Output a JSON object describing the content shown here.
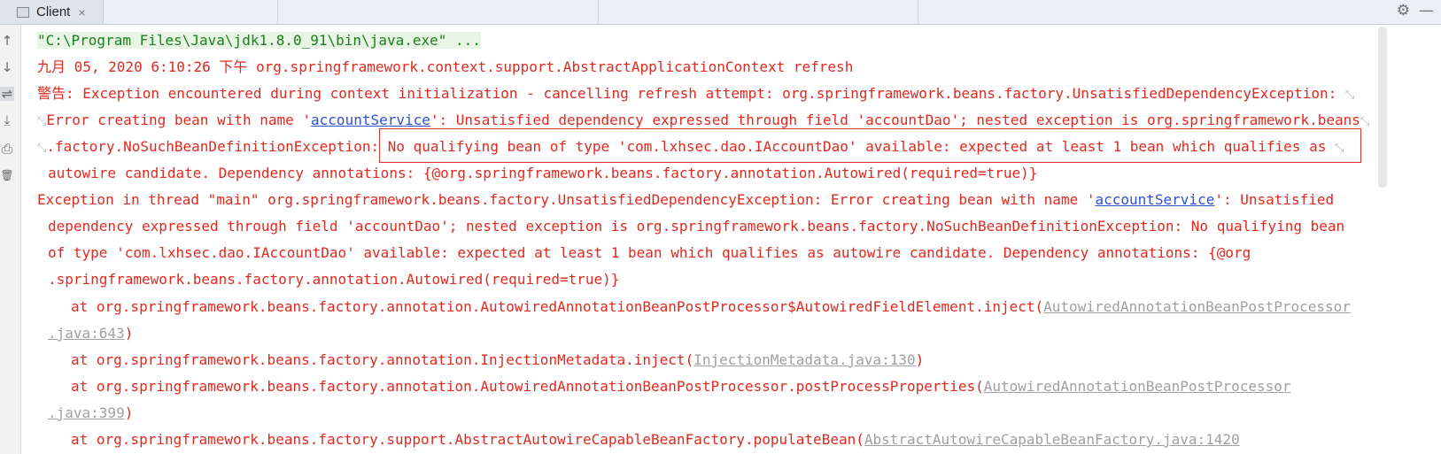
{
  "tab": {
    "label": "Client",
    "close": "×",
    "icon": "console-icon"
  },
  "toolbar_right": {
    "settings_icon": "gear-icon",
    "settings_glyph": "⚙",
    "minimize_icon": "minimize-icon",
    "minimize_glyph": "—"
  },
  "tools": [
    {
      "name": "up-arrow-icon",
      "glyph": "↑"
    },
    {
      "name": "down-arrow-icon",
      "glyph": "↓"
    },
    {
      "name": "soft-wrap-icon",
      "glyph": "⇌"
    },
    {
      "name": "scroll-to-end-icon",
      "glyph": "⤓"
    },
    {
      "name": "print-icon",
      "glyph": "⎙"
    },
    {
      "name": "trash-icon",
      "glyph": "🗑"
    }
  ],
  "colors": {
    "error": "#e0291f",
    "link": "#2d51d1",
    "source": "#a0a0a0",
    "command": "#1b7f1b",
    "highlight_box": "#d9342b"
  },
  "console": {
    "cmd": "\"C:\\Program Files\\Java\\jdk1.8.0_91\\bin\\java.exe\" ...",
    "l1": "九月 05, 2020 6:10:26 下午 org.springframework.context.support.AbstractApplicationContext refresh",
    "l2": "警告: Exception encountered during context initialization - cancelling refresh attempt: org.springframework.beans.factory.UnsatisfiedDependencyException: ",
    "l3a": "Error creating bean with name '",
    "bean_link": "accountService",
    "l3b": "': Unsatisfied dependency expressed through field 'accountDao'; nested exception is org.springframework.beans",
    "l4a": ".factory.NoSuchBeanDefinitionException: ",
    "l4b": "No qualifying bean of type 'com.lxhsec.dao.IAccountDao' available: expected at least 1 bean which qualifies as ",
    "l5": "autowire candidate. Dependency annotations: {@org.springframework.beans.factory.annotation.Autowired(required=true)}",
    "l6a": "Exception in thread \"main\" org.springframework.beans.factory.UnsatisfiedDependencyException: Error creating bean with name '",
    "l6b": "': Unsatisfied",
    "l7": "dependency expressed through field 'accountDao'; nested exception is org.springframework.beans.factory.NoSuchBeanDefinitionException: No qualifying bean",
    "l8": "of type 'com.lxhsec.dao.IAccountDao' available: expected at least 1 bean which qualifies as autowire candidate. Dependency annotations: {@org",
    "l9": ".springframework.beans.factory.annotation.Autowired(required=true)}",
    "l10a": "at org.springframework.beans.factory.annotation.AutowiredAnnotationBeanPostProcessor$AutowiredFieldElement.inject(",
    "l10src": "AutowiredAnnotationBeanPostProcessor",
    "l11src": ".java:643",
    "close_paren": ")",
    "l12a": "at org.springframework.beans.factory.annotation.InjectionMetadata.inject(",
    "l12src": "InjectionMetadata.java:130",
    "l13a": "at org.springframework.beans.factory.annotation.AutowiredAnnotationBeanPostProcessor.postProcessProperties(",
    "l13src": "AutowiredAnnotationBeanPostProcessor",
    "l14src": ".java:399",
    "l15a": "at org.springframework.beans.factory.support.AbstractAutowireCapableBeanFactory.populateBean(",
    "l15src": "AbstractAutowireCapableBeanFactory.java:1420",
    "wrap_glyph": "⤡"
  }
}
